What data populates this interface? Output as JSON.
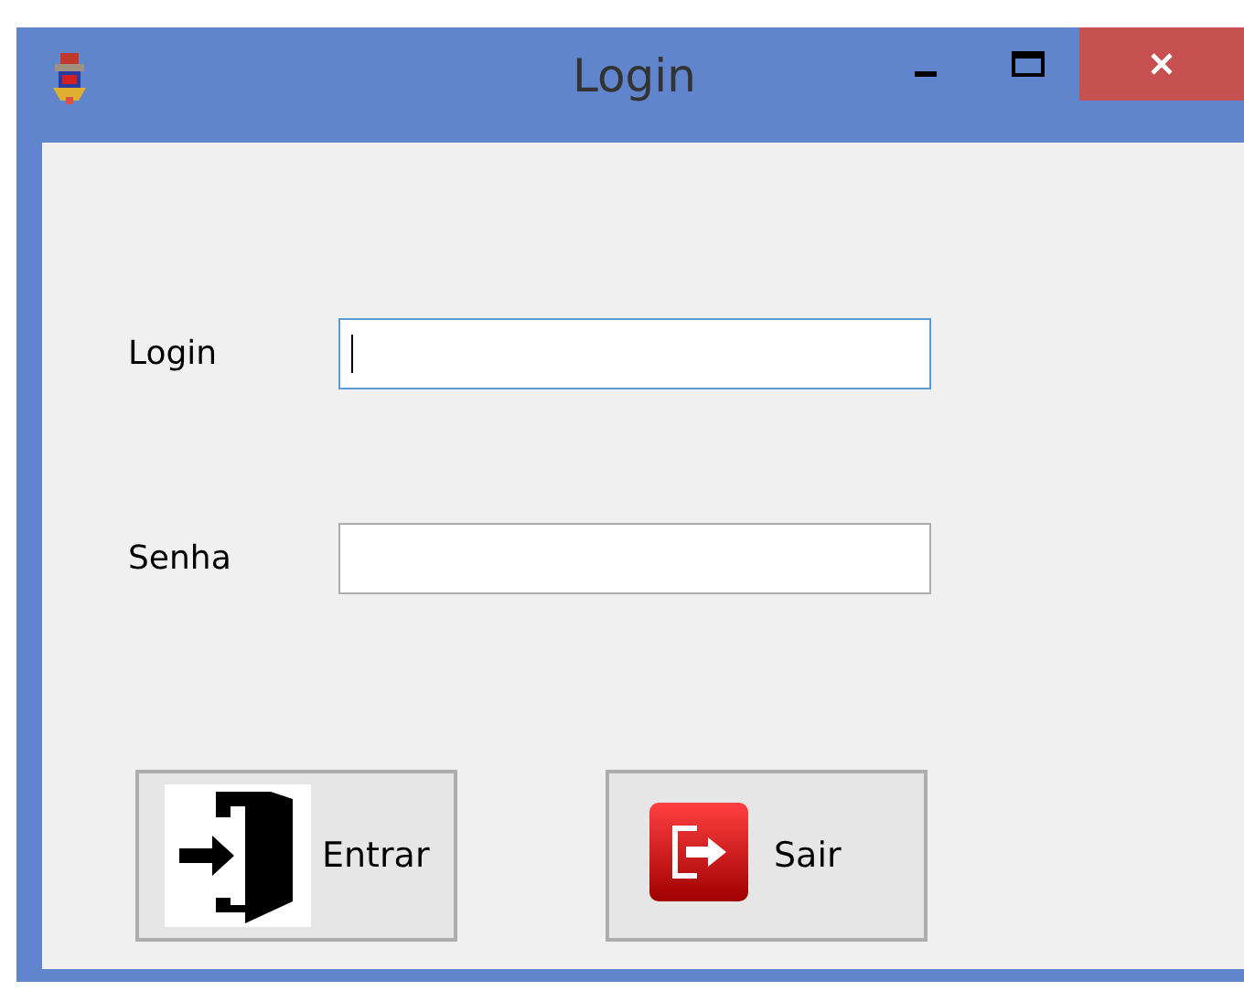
{
  "window": {
    "title": "Login"
  },
  "fields": [
    {
      "label": "Login",
      "focused": true
    },
    {
      "label": "Senha",
      "focused": false
    }
  ],
  "buttons": [
    {
      "label": "Entrar",
      "kind": "enter"
    },
    {
      "label": "Sair",
      "kind": "exit"
    }
  ]
}
